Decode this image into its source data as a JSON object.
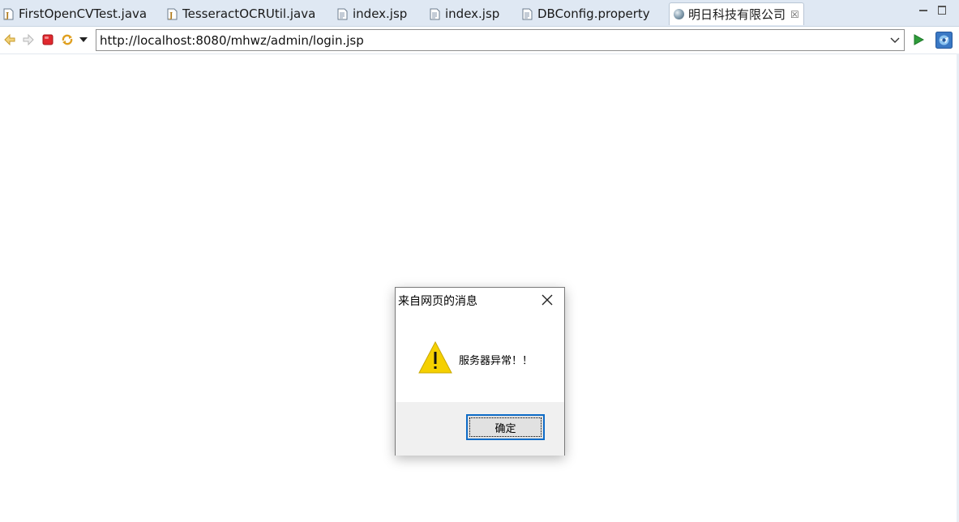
{
  "tabs": [
    {
      "label": "FirstOpenCVTest.java",
      "icon": "java-file-icon"
    },
    {
      "label": "TesseractOCRUtil.java",
      "icon": "java-file-icon"
    },
    {
      "label": "index.jsp",
      "icon": "jsp-file-icon"
    },
    {
      "label": "index.jsp",
      "icon": "jsp-file-icon"
    },
    {
      "label": "DBConfig.property",
      "icon": "text-file-icon"
    },
    {
      "label": "明日科技有限公司",
      "icon": "globe-icon",
      "active": true,
      "close": "☒"
    }
  ],
  "browser": {
    "url": "http://localhost:8080/mhwz/admin/login.jsp"
  },
  "dialog": {
    "title": "来自网页的消息",
    "message": "服务器异常！！",
    "ok_label": "确定",
    "icon": "warning-icon"
  },
  "colors": {
    "tabbar_bg": "#dfe8f3",
    "accent_blue": "#0f6cc7",
    "warning_yellow": "#f5d000",
    "stop_red": "#e0282e",
    "go_green": "#2e9c3a"
  }
}
